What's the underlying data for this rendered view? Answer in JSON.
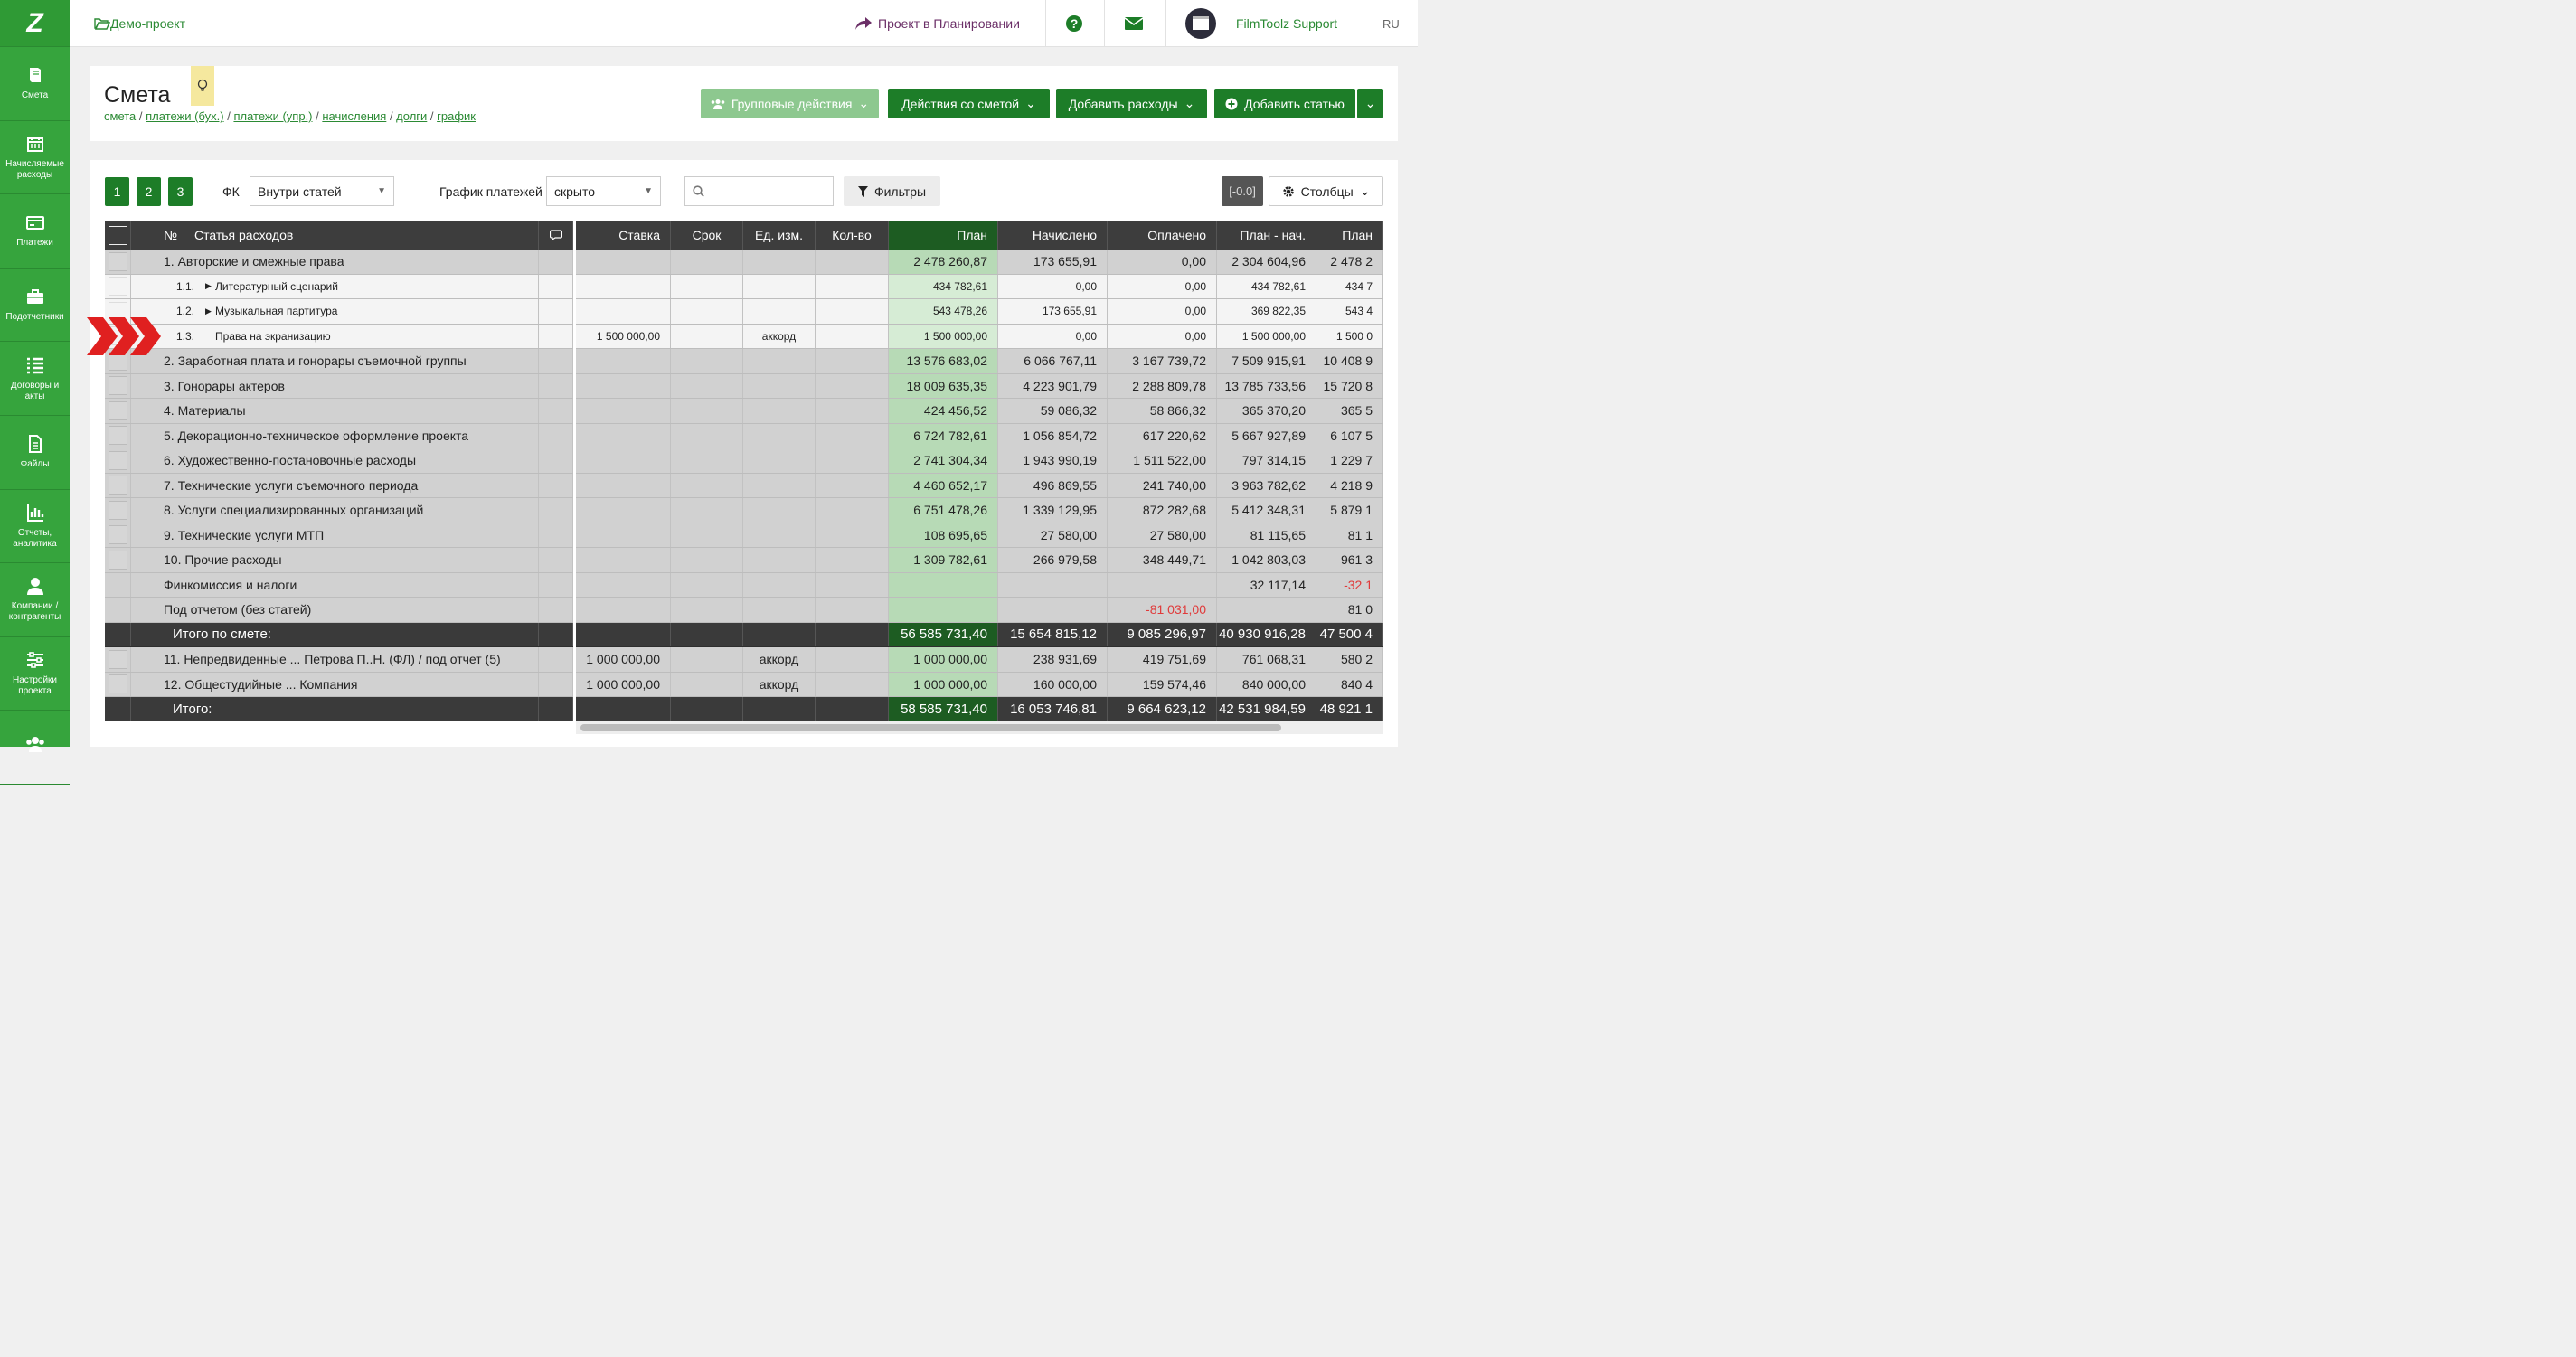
{
  "sidebar": {
    "logo": "Z",
    "items": [
      {
        "label": "Смета",
        "icon": "book-icon"
      },
      {
        "label": "Начисляемые расходы",
        "icon": "calendar-icon"
      },
      {
        "label": "Платежи",
        "icon": "credit-card-icon"
      },
      {
        "label": "Подотчетники",
        "icon": "briefcase-icon"
      },
      {
        "label": "Договоры и акты",
        "icon": "list-icon"
      },
      {
        "label": "Файлы",
        "icon": "file-icon"
      },
      {
        "label": "Отчеты, аналитика",
        "icon": "bar-chart-icon"
      },
      {
        "label": "Компании / контрагенты",
        "icon": "user-icon"
      },
      {
        "label": "Настройки проекта",
        "icon": "sliders-icon"
      },
      {
        "label": "",
        "icon": "users-icon"
      }
    ]
  },
  "topbar": {
    "project": "Демо-проект",
    "planning": "Проект в Планировании",
    "support": "FilmToolz Support",
    "lang": "RU"
  },
  "header": {
    "title": "Смета",
    "breadcrumb": {
      "first": "смета",
      "links": [
        "платежи (бух.)",
        "платежи (упр.)",
        "начисления",
        "долги",
        "график"
      ]
    },
    "buttons": {
      "group": "Групповые действия",
      "estimate": "Действия со сметой",
      "expenses": "Добавить расходы",
      "add": "Добавить статью"
    }
  },
  "toolbar": {
    "levels": [
      "1",
      "2",
      "3"
    ],
    "fk_label": "ФК",
    "fk_value": "Внутри статей",
    "schedule_label": "График платежей",
    "schedule_value": "скрыто",
    "search_placeholder": "",
    "filters": "Фильтры",
    "zero": "[-0.0]",
    "columns": "Столбцы"
  },
  "table": {
    "headers": {
      "num": "№",
      "name": "Статья расходов",
      "rate": "Ставка",
      "term": "Срок",
      "unit": "Ед. изм.",
      "qty": "Кол-во",
      "plan": "План",
      "accrued": "Начислено",
      "paid": "Оплачено",
      "plan_acc": "План - нач.",
      "plan2": "План"
    },
    "rows": [
      {
        "type": "group",
        "name": "1. Авторские и смежные права",
        "plan": "2 478 260,87",
        "accrued": "173 655,91",
        "paid": "0,00",
        "plan_acc": "2 304 604,96",
        "plan2": "2 478 2"
      },
      {
        "type": "sub",
        "num": "1.1.",
        "expand": true,
        "name": "Литературный сценарий",
        "plan": "434 782,61",
        "accrued": "0,00",
        "paid": "0,00",
        "plan_acc": "434 782,61",
        "plan2": "434 7"
      },
      {
        "type": "sub",
        "num": "1.2.",
        "expand": true,
        "name": "Музыкальная партитура",
        "plan": "543 478,26",
        "accrued": "173 655,91",
        "paid": "0,00",
        "plan_acc": "369 822,35",
        "plan2": "543 4"
      },
      {
        "type": "sub",
        "num": "1.3.",
        "expand": false,
        "name": "Права на экранизацию",
        "rate": "1 500 000,00",
        "unit": "аккорд",
        "plan": "1 500 000,00",
        "accrued": "0,00",
        "paid": "0,00",
        "plan_acc": "1 500 000,00",
        "plan2": "1 500 0"
      },
      {
        "type": "group",
        "name": "2. Заработная плата и гонорары съемочной группы",
        "plan": "13 576 683,02",
        "accrued": "6 066 767,11",
        "paid": "3 167 739,72",
        "plan_acc": "7 509 915,91",
        "plan2": "10 408 9"
      },
      {
        "type": "group",
        "name": "3. Гонорары актеров",
        "plan": "18 009 635,35",
        "accrued": "4 223 901,79",
        "paid": "2 288 809,78",
        "plan_acc": "13 785 733,56",
        "plan2": "15 720 8"
      },
      {
        "type": "group",
        "name": "4. Материалы",
        "plan": "424 456,52",
        "accrued": "59 086,32",
        "paid": "58 866,32",
        "plan_acc": "365 370,20",
        "plan2": "365 5"
      },
      {
        "type": "group",
        "name": "5. Декорационно-техническое оформление проекта",
        "plan": "6 724 782,61",
        "accrued": "1 056 854,72",
        "paid": "617 220,62",
        "plan_acc": "5 667 927,89",
        "plan2": "6 107 5"
      },
      {
        "type": "group",
        "name": "6. Художественно-постановочные расходы",
        "plan": "2 741 304,34",
        "accrued": "1 943 990,19",
        "paid": "1 511 522,00",
        "plan_acc": "797 314,15",
        "plan2": "1 229 7"
      },
      {
        "type": "group",
        "camera": true,
        "name": "7. Технические услуги съемочного периода",
        "plan": "4 460 652,17",
        "accrued": "496 869,55",
        "paid": "241 740,00",
        "plan_acc": "3 963 782,62",
        "plan2": "4 218 9"
      },
      {
        "type": "group",
        "name": "8. Услуги специализированных организаций",
        "plan": "6 751 478,26",
        "accrued": "1 339 129,95",
        "paid": "872 282,68",
        "plan_acc": "5 412 348,31",
        "plan2": "5 879 1"
      },
      {
        "type": "group",
        "name": "9. Технические услуги МТП",
        "plan": "108 695,65",
        "accrued": "27 580,00",
        "paid": "27 580,00",
        "plan_acc": "81 115,65",
        "plan2": "81 1"
      },
      {
        "type": "group",
        "name": "10. Прочие расходы",
        "plan": "1 309 782,61",
        "accrued": "266 979,58",
        "paid": "348 449,71",
        "plan_acc": "1 042 803,03",
        "plan2": "961 3"
      },
      {
        "type": "special",
        "name": "Финкомиссия и налоги",
        "plan": "",
        "accrued": "",
        "paid": "",
        "plan_acc": "32 117,14",
        "plan2": "-32 1",
        "neg_plan2": true
      },
      {
        "type": "special",
        "name": "Под отчетом (без статей)",
        "plan": "",
        "accrued": "",
        "paid": "-81 031,00",
        "neg_paid": true,
        "plan_acc": "",
        "plan2": "81 0"
      },
      {
        "type": "total",
        "name": "Итого по смете:",
        "plan": "56 585 731,40",
        "accrued": "15 654 815,12",
        "paid": "9 085 296,97",
        "plan_acc": "40 930 916,28",
        "plan2": "47 500 4"
      },
      {
        "type": "group",
        "name": "11. Непредвиденные ... Петрова П..Н. (ФЛ) / под отчет (5)",
        "rate": "1 000 000,00",
        "unit": "аккорд",
        "plan": "1 000 000,00",
        "accrued": "238 931,69",
        "paid": "419 751,69",
        "plan_acc": "761 068,31",
        "plan2": "580 2"
      },
      {
        "type": "group",
        "name": "12. Общестудийные ... Компания",
        "rate": "1 000 000,00",
        "unit": "аккорд",
        "plan": "1 000 000,00",
        "accrued": "160 000,00",
        "paid": "159 574,46",
        "plan_acc": "840 000,00",
        "plan2": "840 4"
      },
      {
        "type": "total",
        "name": "Итого:",
        "plan": "58 585 731,40",
        "accrued": "16 053 746,81",
        "paid": "9 664 623,12",
        "plan_acc": "42 531 984,59",
        "plan2": "48 921 1"
      }
    ]
  },
  "colors": {
    "green": "#36a43d",
    "dark_green": "#1d7d28",
    "light_green": "#8dc88f",
    "plan_cell": "#b7dab6",
    "plan_sub": "#d6ecd5",
    "total": "#3a3a3a",
    "purple": "#6b2f67",
    "red": "#e03a3a"
  }
}
